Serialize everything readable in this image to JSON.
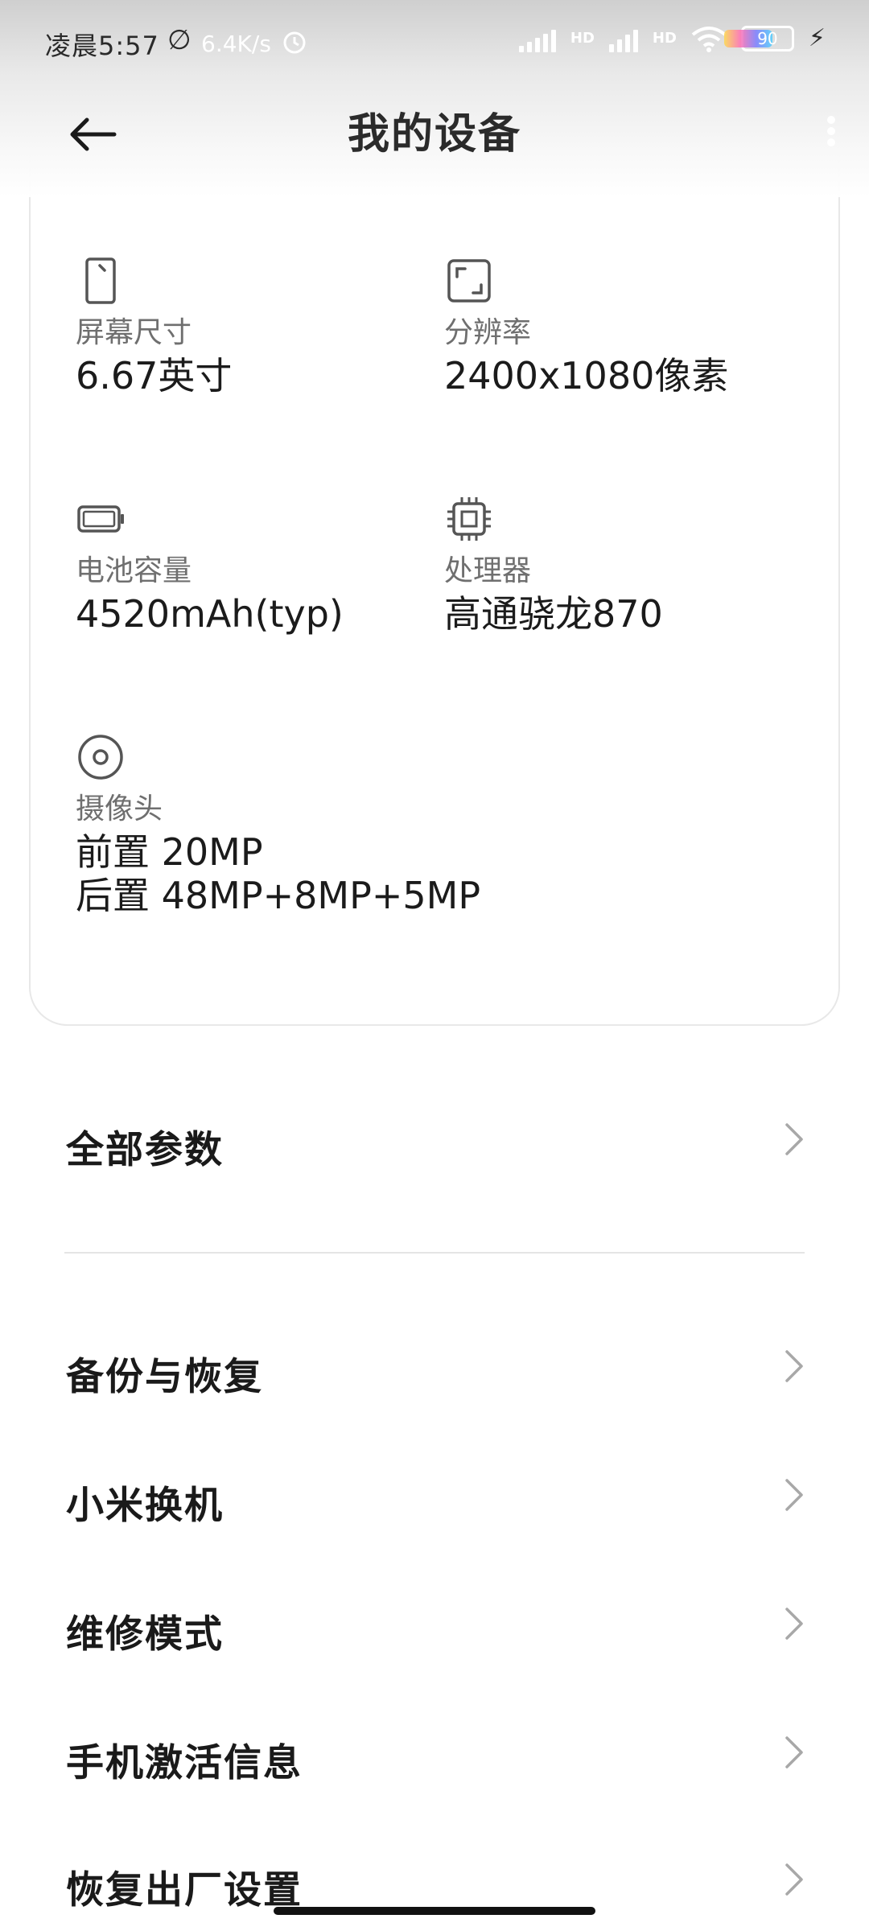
{
  "status_bar": {
    "time": "凌晨5:57",
    "net_speed": "6.4K/s",
    "hd_label_1": "HD",
    "hd_label_2": "HD",
    "battery": "90"
  },
  "header": {
    "title": "我的设备",
    "back_icon": "arrow-left-icon",
    "more_icon": "more-vertical-icon"
  },
  "specs": [
    {
      "icon": "screen-size-icon",
      "label": "屏幕尺寸",
      "value": "6.67英寸"
    },
    {
      "icon": "resolution-icon",
      "label": "分辨率",
      "value": "2400x1080像素"
    },
    {
      "icon": "battery-icon",
      "label": "电池容量",
      "value": "4520mAh(typ)"
    },
    {
      "icon": "processor-icon",
      "label": "处理器",
      "value": "高通骁龙870"
    },
    {
      "icon": "camera-icon",
      "label": "摄像头",
      "value_front": "前置 20MP",
      "value_rear": "后置 48MP+8MP+5MP"
    }
  ],
  "menu": {
    "all_params": "全部参数",
    "items": [
      {
        "label": "备份与恢复"
      },
      {
        "label": "小米换机"
      },
      {
        "label": "维修模式"
      },
      {
        "label": "手机激活信息"
      },
      {
        "label": "恢复出厂设置"
      }
    ]
  },
  "colors": {
    "text_primary": "#1a1a1a",
    "text_secondary": "#6f6f6f",
    "divider": "#e5e5e5"
  }
}
